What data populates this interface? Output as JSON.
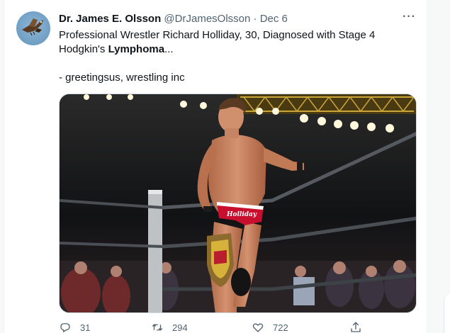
{
  "tweet": {
    "author_name": "Dr. James E. Olsson",
    "handle": "@DrJamesOlsson",
    "separator": "·",
    "date": "Dec 6",
    "more_label": "···",
    "text_line1": "Professional Wrestler Richard Holliday, 30, Diagnosed with Stage 4",
    "text_line2_prefix": "Hodgkin's ",
    "text_line2_bold": "Lymphoma",
    "text_line2_suffix": "...",
    "text_line3": "- greetingsus, wrestling inc",
    "media": {
      "trunks_text": "Holliday"
    },
    "actions": {
      "reply_count": "31",
      "retweet_count": "294",
      "like_count": "722"
    }
  },
  "colors": {
    "text_primary": "#0f1419",
    "text_secondary": "#536471",
    "background": "#f7f9f9"
  },
  "icons": [
    "bird-avatar-icon",
    "more-icon",
    "reply-icon",
    "retweet-icon",
    "like-icon",
    "share-icon"
  ]
}
